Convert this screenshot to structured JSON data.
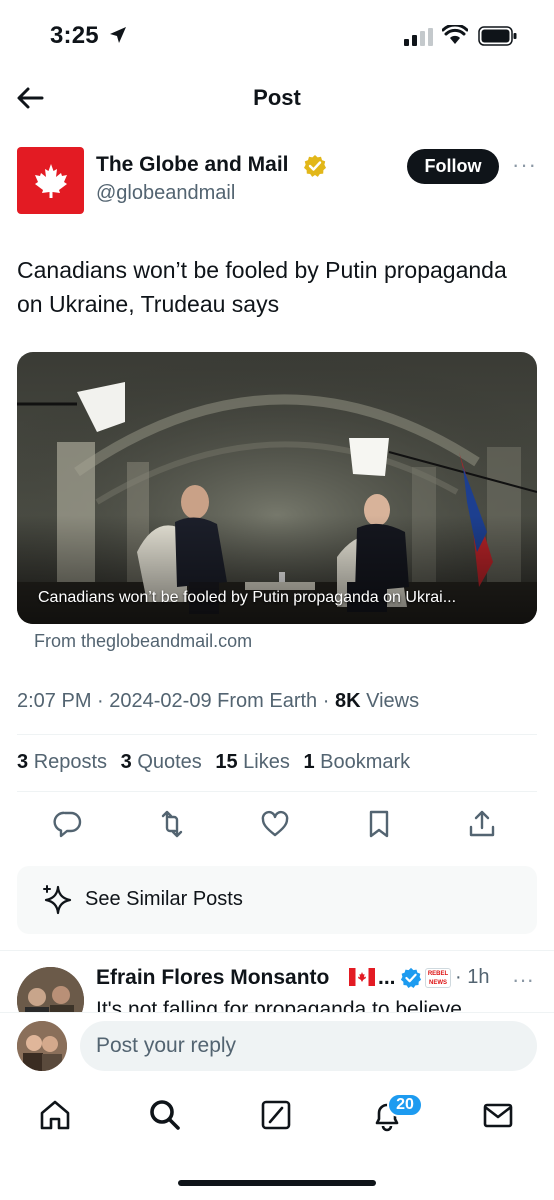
{
  "status_bar": {
    "time": "3:25"
  },
  "header": {
    "title": "Post"
  },
  "author": {
    "name": "The Globe and Mail",
    "handle": "@globeandmail",
    "follow_label": "Follow"
  },
  "post": {
    "text": "Canadians won’t be fooled by Putin propaganda on Ukraine, Trudeau says",
    "card_caption": "Canadians won’t be fooled by Putin propaganda on Ukrai...",
    "card_source": "From theglobeandmail.com",
    "time": "2:07 PM",
    "date": "2024-02-09",
    "location": "From Earth",
    "views_count": "8K",
    "views_label": "Views"
  },
  "stats": {
    "reposts_count": "3",
    "reposts_label": "Reposts",
    "quotes_count": "3",
    "quotes_label": "Quotes",
    "likes_count": "15",
    "likes_label": "Likes",
    "bookmarks_count": "1",
    "bookmarks_label": "Bookmark"
  },
  "similar": {
    "label": "See Similar Posts"
  },
  "reply": {
    "name": "Efrain Flores Monsanto",
    "ellipsis": "...",
    "time": "1h",
    "badge": "REBEL NEWS",
    "text": "It's not falling for propaganda to believe"
  },
  "compose": {
    "placeholder": "Post your reply"
  },
  "tabbar": {
    "notifications_count": "20"
  },
  "colors": {
    "accent": "#1d9bf0",
    "brand": "#e31b23",
    "verified_gold": "#e2b719"
  },
  "icons": [
    "back-arrow-icon",
    "maple-leaf-icon",
    "verified-gold-icon",
    "reply-icon",
    "repost-icon",
    "like-icon",
    "bookmark-icon",
    "share-icon",
    "sparkle-icon",
    "home-icon",
    "search-icon",
    "grok-icon",
    "bell-icon",
    "mail-icon"
  ]
}
